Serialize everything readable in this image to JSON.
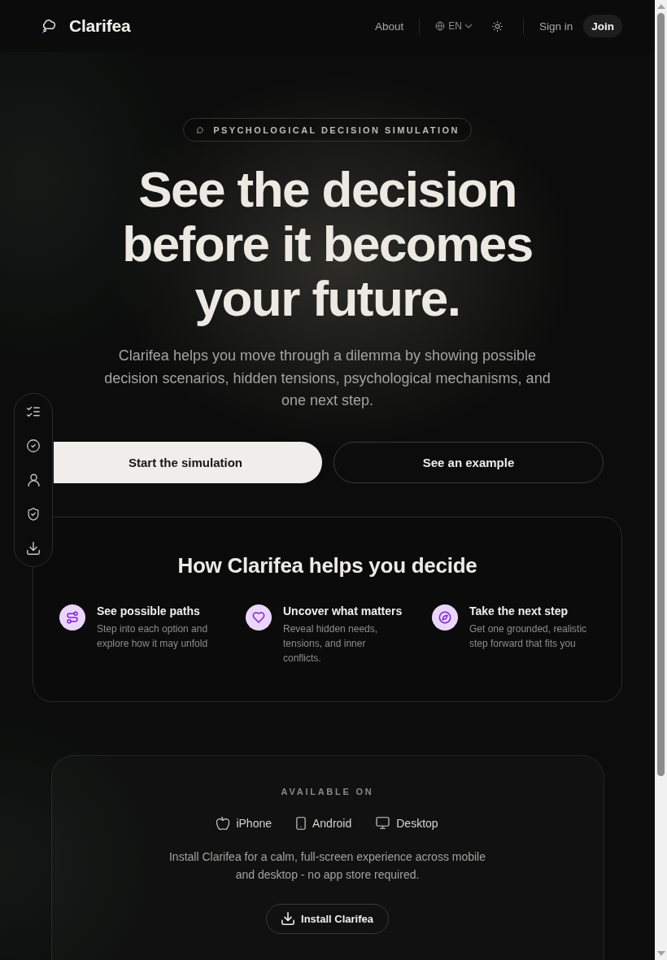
{
  "header": {
    "brand": "Clarifea",
    "nav": [
      {
        "label": "About"
      }
    ],
    "language": "EN",
    "sign_in": "Sign in",
    "join": "Join"
  },
  "hero": {
    "badge": "PSYCHOLOGICAL DECISION SIMULATION",
    "headline": "See the decision before it becomes your future.",
    "lead": "Clarifea helps you move through a dilemma by showing possible decision scenarios, hidden tensions, psychological mechanisms, and one next step.",
    "actions": [
      {
        "label": "Start the simulation",
        "kind": "primary"
      },
      {
        "label": "See an example",
        "kind": "secondary"
      }
    ]
  },
  "how_it_helps": {
    "title": "How Clarifea helps you decide",
    "features": [
      {
        "title": "See possible paths",
        "text": "Step into each option and explore how it may unfold"
      },
      {
        "title": "Uncover what matters",
        "text": "Reveal hidden needs, tensions, and inner conflicts."
      },
      {
        "title": "Take the next step",
        "text": "Get one grounded, realistic step forward that fits you"
      }
    ]
  },
  "availability": {
    "label": "AVAILABLE ON",
    "platforms": [
      {
        "label": "iPhone"
      },
      {
        "label": "Android"
      },
      {
        "label": "Desktop"
      }
    ],
    "text": "Install Clarifea for a calm, full-screen experience across mobile and desktop - no app store required.",
    "install": "Install Clarifea"
  }
}
